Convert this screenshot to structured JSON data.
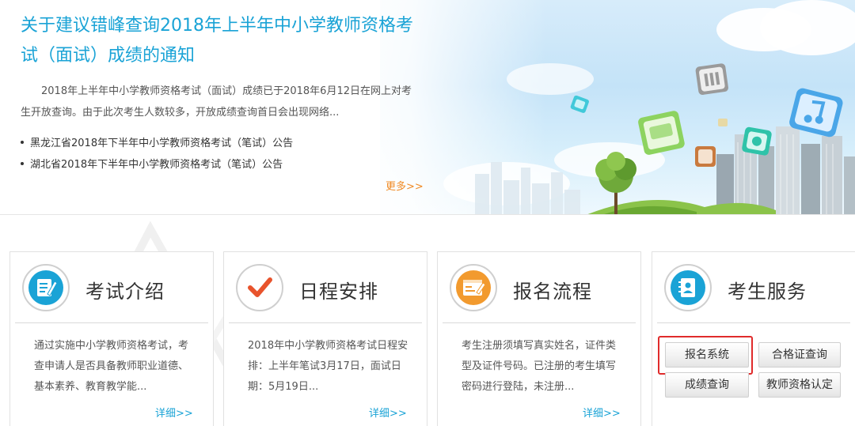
{
  "banner": {
    "news_title": "关于建议错峰查询2018年上半年中小学教师资格考试（面试）成绩的通知",
    "news_summary": "2018年上半年中小学教师资格考试（面试）成绩已于2018年6月12日在网上对考生开放查询。由于此次考生人数较多，开放成绩查询首日会出现网络...",
    "news_items": [
      {
        "label": "黑龙江省2018年下半年中小学教师资格考试（笔试）公告"
      },
      {
        "label": "湖北省2018年下半年中小学教师资格考试（笔试）公告"
      }
    ],
    "more_label": "更多>>"
  },
  "cards": {
    "exam_intro": {
      "title": "考试介绍",
      "desc": "通过实施中小学教师资格考试，考查申请人是否具备教师职业道德、基本素养、教育教学能...",
      "detail_label": "详细>>",
      "icon": "document-edit-icon",
      "color": "#1aa3d6"
    },
    "schedule": {
      "title": "日程安排",
      "desc": "2018年中小学教师资格考试日程安排：上半年笔试3月17日，面试日期：5月19日...",
      "detail_label": "详细>>",
      "icon": "checkmark-icon",
      "color": "#e8532c"
    },
    "registration_process": {
      "title": "报名流程",
      "desc": "考生注册须填写真实姓名，证件类型及证件号码。已注册的考生填写密码进行登陆，未注册...",
      "detail_label": "详细>>",
      "icon": "form-edit-icon",
      "color": "#f29a2e"
    },
    "candidate_services": {
      "title": "考生服务",
      "icon": "contact-book-icon",
      "color": "#1aa3d6",
      "buttons": [
        {
          "label": "报名系统"
        },
        {
          "label": "合格证查询"
        },
        {
          "label": "成绩查询"
        },
        {
          "label": "教师资格认定"
        }
      ],
      "highlight_color": "#e02b2b"
    }
  }
}
